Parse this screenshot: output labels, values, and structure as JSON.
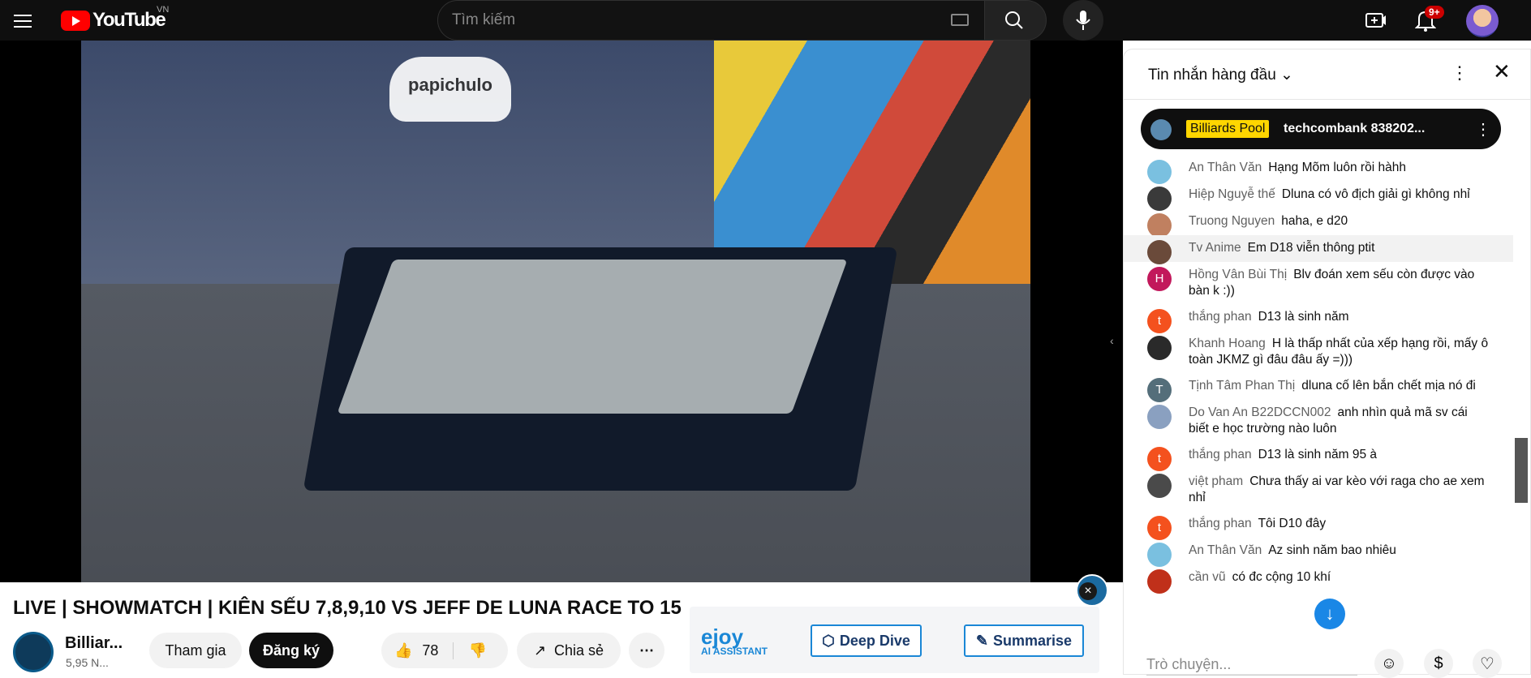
{
  "header": {
    "logo_text": "YouTube",
    "country": "VN",
    "search_placeholder": "Tìm kiếm",
    "notifications": "9+"
  },
  "video": {
    "title": "LIVE | SHOWMATCH | KIÊN SẾU 7,8,9,10 VS JEFF DE LUNA RACE TO 15",
    "sign_text": "papichulo"
  },
  "channel": {
    "name": "Billiar...",
    "subs": "5,95 N...",
    "join_label": "Tham gia",
    "subscribe_label": "Đăng ký",
    "likes": "78",
    "share_label": "Chia sẻ"
  },
  "ejoy": {
    "brand": "ejoy",
    "sub": "AI ASSISTANT",
    "deep_dive": "Deep Dive",
    "summarise": "Summarise"
  },
  "chat": {
    "header": "Tin nhắn hàng đầu",
    "pinned": {
      "tag": "Billiards Pool",
      "message": "techcombank 838202..."
    },
    "messages": [
      {
        "author": "An Thân Văn",
        "text": "Hạng Mõm luôn rồi hàhh",
        "avatar": "",
        "color": "#7ac0e0"
      },
      {
        "author": "Hiệp Nguyễ thế",
        "text": "Dluna có vô địch giải gì không nhỉ",
        "avatar": "",
        "color": "#3a3a3a"
      },
      {
        "author": "Truong Nguyen",
        "text": "haha, e d20",
        "avatar": "",
        "color": "#c08060"
      },
      {
        "author": "Tv Anime",
        "text": "Em D18 viễn thông ptit",
        "avatar": "",
        "color": "#6a4a3a"
      },
      {
        "author": "Hồng Vân Bùi Thị",
        "text": "Blv đoán xem sếu còn được vào bàn k :))",
        "avatar": "H",
        "color": "#c2185b"
      },
      {
        "author": "thắng phan",
        "text": "D13 là sinh năm",
        "avatar": "t",
        "color": "#f4511e"
      },
      {
        "author": "Khanh Hoang",
        "text": "H là thấp nhất của xếp hạng rồi, mấy ô toàn JKMZ gì đâu đâu ấy =)))",
        "avatar": "",
        "color": "#2a2a2a"
      },
      {
        "author": "Tịnh Tâm Phan Thị",
        "text": "dluna cố lên bắn chết mịa nó đi",
        "avatar": "T",
        "color": "#546e7a"
      },
      {
        "author": "Do Van An B22DCCN002",
        "text": "anh nhìn quả mã sv cái biết e học trường nào luôn",
        "avatar": "",
        "color": "#8aa0c0"
      },
      {
        "author": "thắng phan",
        "text": "D13 là sinh năm 95 à",
        "avatar": "t",
        "color": "#f4511e"
      },
      {
        "author": "việt pham",
        "text": "Chưa thấy ai var kèo với raga cho ae xem nhỉ",
        "avatar": "",
        "color": "#4a4a4a"
      },
      {
        "author": "thắng phan",
        "text": "Tôi D10 đây",
        "avatar": "t",
        "color": "#f4511e"
      },
      {
        "author": "An Thân Văn",
        "text": "Az sinh năm bao nhiêu",
        "avatar": "",
        "color": "#7ac0e0"
      },
      {
        "author": "cần vũ",
        "text": "có đc cộng 10 khí",
        "avatar": "",
        "color": "#c0301a"
      }
    ],
    "input_placeholder": "Trò chuyện..."
  }
}
